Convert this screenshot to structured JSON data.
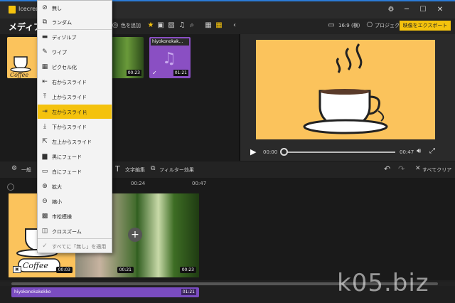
{
  "window": {
    "title": "Icecream"
  },
  "header": {
    "title": "メディア",
    "add_color": "色を追加",
    "aspect": "16:9 (横)",
    "project": "プロジェクト",
    "export": "映像をエクスポート"
  },
  "library": {
    "items": [
      {
        "type": "image",
        "duration": ""
      },
      {
        "type": "video",
        "duration": "00:23"
      },
      {
        "type": "audio",
        "name": "hiyokonokak...",
        "duration": "01:21"
      }
    ]
  },
  "player": {
    "current": "00:00",
    "total": "00:47"
  },
  "toolbar": {
    "general": "一般",
    "text_edit": "文字編集",
    "filter": "フィルター効果",
    "clear_all": "すべてクリア"
  },
  "ruler": {
    "t1": "00:24",
    "t2": "00:47"
  },
  "timeline": {
    "clips": [
      {
        "duration": "00:03"
      },
      {
        "duration": "00:21"
      },
      {
        "duration": "00:23"
      }
    ],
    "audio": {
      "name": "hiyokonokakekko",
      "duration": "01:21"
    }
  },
  "menu": {
    "items": [
      {
        "label": "無し",
        "icon": "no-icon"
      },
      {
        "label": "ランダム",
        "icon": "random-icon"
      },
      {
        "label": "ディゾルブ",
        "icon": "dissolve-icon"
      },
      {
        "label": "ワイプ",
        "icon": "wipe-icon"
      },
      {
        "label": "ピクセル化",
        "icon": "pixelate-icon"
      },
      {
        "label": "右からスライド",
        "icon": "slide-right-icon"
      },
      {
        "label": "上からスライド",
        "icon": "slide-top-icon"
      },
      {
        "label": "左からスライド",
        "icon": "slide-left-icon"
      },
      {
        "label": "下からスライド",
        "icon": "slide-bottom-icon"
      },
      {
        "label": "左上からスライド",
        "icon": "slide-topleft-icon"
      },
      {
        "label": "黒にフェード",
        "icon": "fade-black-icon"
      },
      {
        "label": "白にフェード",
        "icon": "fade-white-icon"
      },
      {
        "label": "拡大",
        "icon": "zoom-in-icon"
      },
      {
        "label": "縮小",
        "icon": "zoom-out-icon"
      },
      {
        "label": "市松模様",
        "icon": "checker-icon"
      },
      {
        "label": "クロスズーム",
        "icon": "crosszoom-icon"
      }
    ],
    "apply_all": "すべてに「無し」を適用",
    "selected_index": 7
  },
  "watermark": "k05.biz",
  "colors": {
    "accent": "#f4c20d",
    "audio": "#7a4cc1",
    "video_bg": "#fbc35c"
  }
}
